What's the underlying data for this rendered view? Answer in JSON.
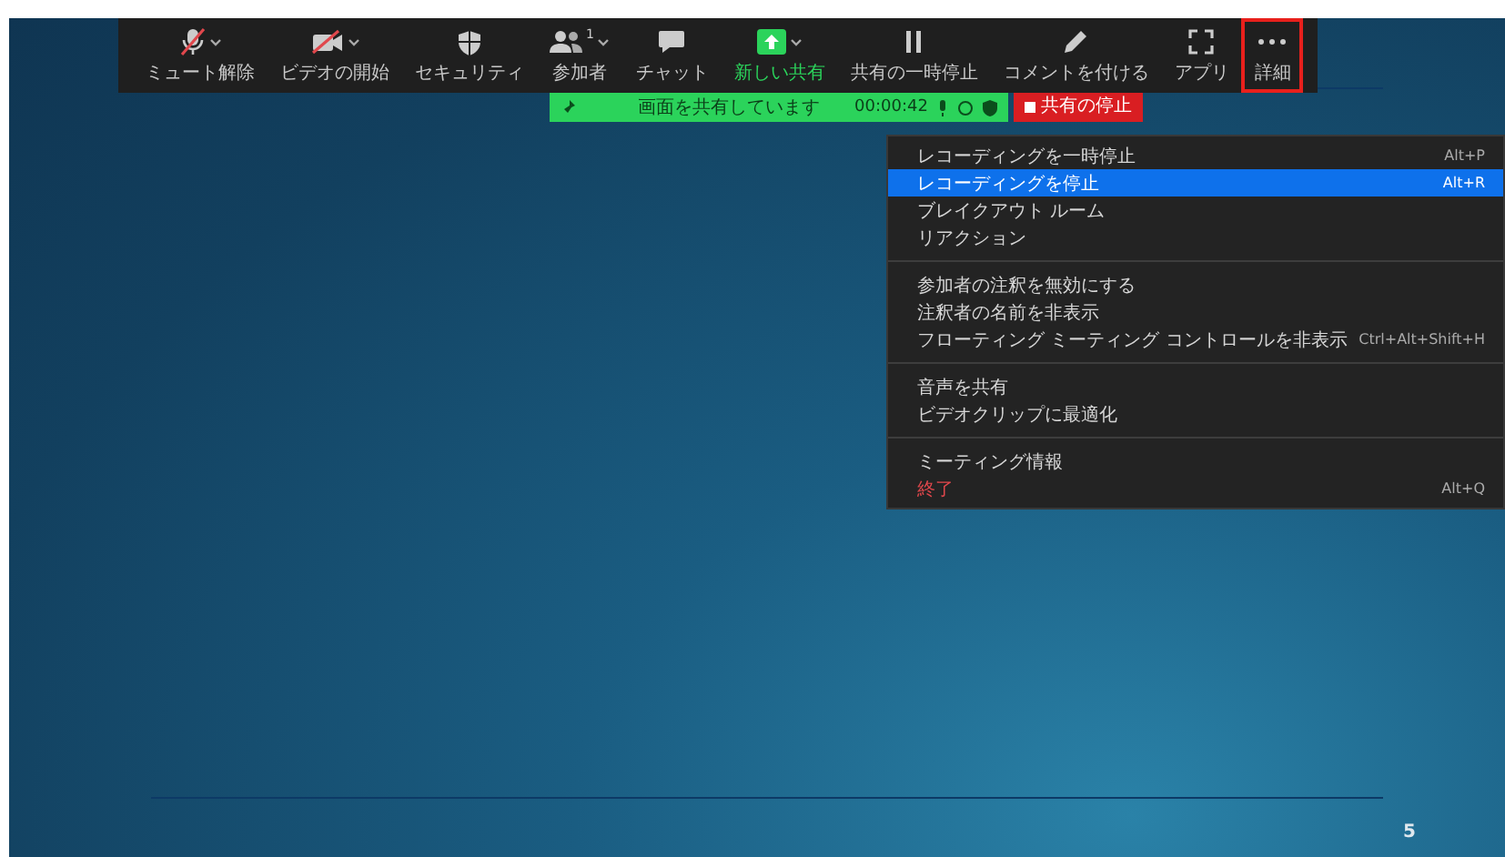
{
  "toolbar": {
    "items": [
      {
        "kind": "mic-muted",
        "label": "ミュート解除",
        "caret": true,
        "highlighted": false
      },
      {
        "kind": "video-off",
        "label": "ビデオの開始",
        "caret": true,
        "highlighted": false
      },
      {
        "kind": "shield",
        "label": "セキュリティ",
        "caret": false,
        "highlighted": false
      },
      {
        "kind": "people",
        "label": "参加者",
        "badge": "1",
        "caret": true,
        "highlighted": false
      },
      {
        "kind": "chat",
        "label": "チャット",
        "caret": false,
        "highlighted": false
      },
      {
        "kind": "share",
        "label": "新しい共有",
        "caret": true,
        "highlighted": false
      },
      {
        "kind": "pause",
        "label": "共有の一時停止",
        "caret": false,
        "highlighted": false
      },
      {
        "kind": "pencil",
        "label": "コメントを付ける",
        "caret": false,
        "highlighted": false
      },
      {
        "kind": "apps",
        "label": "アプリ",
        "caret": false,
        "highlighted": false
      },
      {
        "kind": "more",
        "label": "詳細",
        "caret": false,
        "highlighted": true
      }
    ]
  },
  "share_bar": {
    "status": "画面を共有しています",
    "time": "00:00:42",
    "stop": "共有の停止"
  },
  "menu": {
    "groups": [
      {
        "items": [
          {
            "label": "レコーディングを一時停止",
            "shortcut": "Alt+P",
            "selected": false,
            "kind": "normal"
          },
          {
            "label": "レコーディングを停止",
            "shortcut": "Alt+R",
            "selected": true,
            "kind": "normal"
          },
          {
            "label": "ブレイクアウト ルーム",
            "selected": false,
            "kind": "normal"
          },
          {
            "label": "リアクション",
            "selected": false,
            "kind": "normal"
          }
        ]
      },
      {
        "items": [
          {
            "label": "参加者の注釈を無効にする",
            "selected": false,
            "kind": "normal"
          },
          {
            "label": "注釈者の名前を非表示",
            "selected": false,
            "kind": "normal"
          },
          {
            "label": "フローティング ミーティング コントロールを非表示",
            "shortcut": "Ctrl+Alt+Shift+H",
            "selected": false,
            "kind": "normal"
          }
        ]
      },
      {
        "items": [
          {
            "label": "音声を共有",
            "selected": false,
            "kind": "normal"
          },
          {
            "label": "ビデオクリップに最適化",
            "selected": false,
            "kind": "normal"
          }
        ]
      },
      {
        "items": [
          {
            "label": "ミーティング情報",
            "selected": false,
            "kind": "normal"
          },
          {
            "label": "終了",
            "shortcut": "Alt+Q",
            "selected": false,
            "kind": "danger"
          }
        ]
      }
    ]
  },
  "slide": {
    "page_number": "5"
  }
}
